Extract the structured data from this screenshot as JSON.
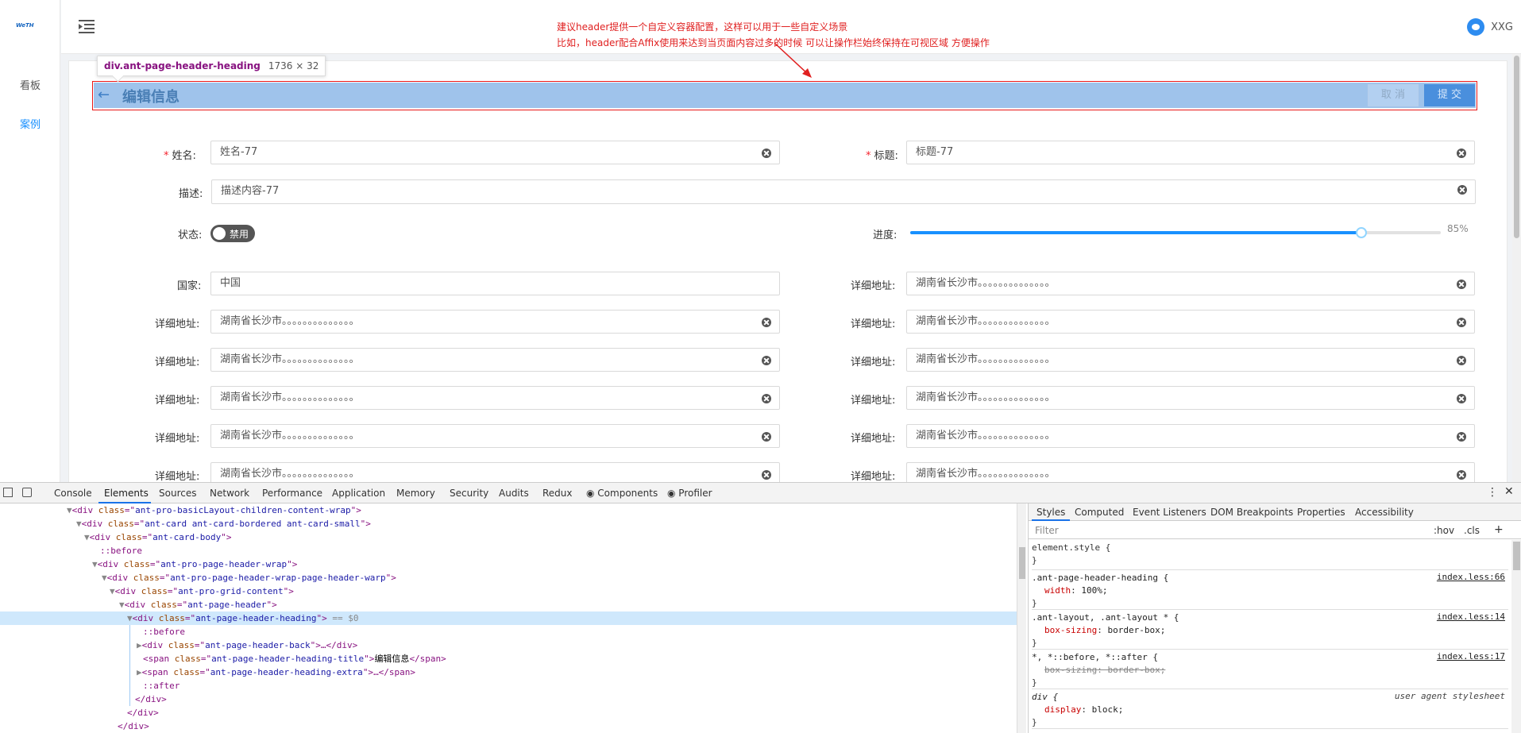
{
  "app": {
    "logo_text": "WeTH",
    "menu": [
      {
        "label": "看板"
      },
      {
        "label": "案例"
      }
    ],
    "annotation_lines": [
      "建议header提供一个自定义容器配置，这样可以用于一些自定义场景",
      "比如，header配合Affix使用来达到当页面内容过多的时候 可以让操作栏始终保持在可视区域 方便操作"
    ],
    "user_name": "XXG",
    "colors": {
      "accent": "#1890ff",
      "annotation": "#e02020"
    }
  },
  "tooltip": {
    "selector": "div.ant-page-header-heading",
    "size": "1736 × 32"
  },
  "page_header": {
    "back_icon": "arrow-left-icon",
    "title": "编辑信息",
    "cancel_label": "取 消",
    "submit_label": "提 交"
  },
  "form": {
    "name": {
      "label": "姓名:",
      "value": "姓名-77"
    },
    "title": {
      "label": "标题:",
      "value": "标题-77"
    },
    "description": {
      "label": "描述:",
      "value": "描述内容-77"
    },
    "status": {
      "label": "状态:",
      "text": "禁用",
      "on": false
    },
    "progress": {
      "label": "进度:",
      "value_text": "85%",
      "percent": 85
    },
    "country": {
      "label": "国家:",
      "value": "中国"
    },
    "address_label": "详细地址:",
    "address_value": "湖南省长沙市。。。。。。。。。。。。。。"
  },
  "devtools": {
    "tabs": [
      "Console",
      "Elements",
      "Sources",
      "Network",
      "Performance",
      "Application",
      "Memory",
      "Security",
      "Audits",
      "Redux",
      "Components",
      "Profiler"
    ],
    "active_tab": "Elements",
    "dom_lines": [
      {
        "tag": "div",
        "class": "ant-pro-basicLayout-children-content-wrap"
      },
      {
        "tag": "div",
        "class": "ant-card ant-card-bordered ant-card-small"
      },
      {
        "tag": "div",
        "class": "ant-card-body"
      },
      {
        "pseudo": "::before"
      },
      {
        "tag": "div",
        "class": "ant-pro-page-header-wrap"
      },
      {
        "tag": "div",
        "class": "ant-pro-page-header-wrap-page-header-warp"
      },
      {
        "tag": "div",
        "class": "ant-pro-grid-content"
      },
      {
        "tag": "div",
        "class": "ant-page-header"
      },
      {
        "tag": "div",
        "class": "ant-page-header-heading",
        "suffix": " == $0"
      },
      {
        "pseudo": "::before"
      },
      {
        "tag": "div",
        "class": "ant-page-header-back",
        "collapsed": "…</div>"
      },
      {
        "tag": "span",
        "class": "ant-page-header-heading-title",
        "text": "编辑信息",
        "close": "</span>"
      },
      {
        "tag": "span",
        "class": "ant-page-header-heading-extra",
        "collapsed": "…</span>"
      },
      {
        "pseudo": "::after"
      },
      {
        "close": "</div>"
      },
      {
        "close": "</div>"
      },
      {
        "close": "</div>"
      }
    ],
    "styles_tabs": [
      "Styles",
      "Computed",
      "Event Listeners",
      "DOM Breakpoints",
      "Properties",
      "Accessibility"
    ],
    "filter_placeholder": "Filter",
    "hov": ":hov",
    "cls": ".cls",
    "plus": "+",
    "rules": [
      {
        "selector": "element.style {",
        "source": "",
        "props": [],
        "close": "}"
      },
      {
        "selector": ".ant-page-header-heading {",
        "source": "index.less:66",
        "props": [
          {
            "name": "width",
            "value": "100%;"
          }
        ],
        "close": "}"
      },
      {
        "selector": ".ant-layout, .ant-layout * {",
        "source": "index.less:14",
        "props": [
          {
            "name": "box-sizing",
            "value": "border-box;"
          }
        ],
        "close": "}"
      },
      {
        "selector": "*, *::before, *::after {",
        "source": "index.less:17",
        "props": [
          {
            "name": "box-sizing",
            "value": "border-box;",
            "struck": true
          }
        ],
        "close": "}"
      },
      {
        "selector": "div {",
        "source": "user agent stylesheet",
        "props": [
          {
            "name": "display",
            "value": "block;"
          }
        ],
        "close": "}"
      }
    ]
  }
}
